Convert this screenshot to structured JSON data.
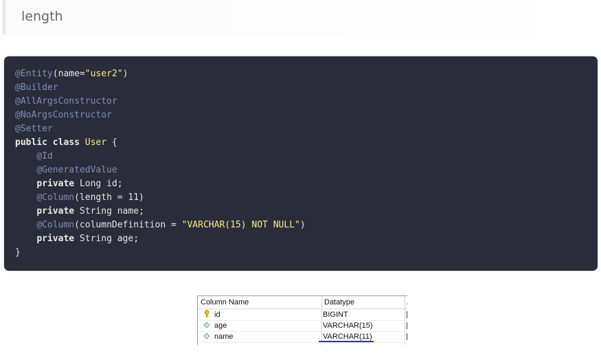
{
  "heading": {
    "text": "length"
  },
  "code_lines": [
    [
      {
        "t": "@Entity",
        "c": "ann"
      },
      {
        "t": "(name="
      },
      {
        "t": "\"user2\"",
        "c": "str"
      },
      {
        "t": ")"
      }
    ],
    [
      {
        "t": "@Builder",
        "c": "ann"
      }
    ],
    [
      {
        "t": "@AllArgsConstructor",
        "c": "ann"
      }
    ],
    [
      {
        "t": "@NoArgsConstructor",
        "c": "ann"
      }
    ],
    [
      {
        "t": "@Setter",
        "c": "ann"
      }
    ],
    [
      {
        "t": "public",
        "c": "kw"
      },
      {
        "t": " "
      },
      {
        "t": "class",
        "c": "kw"
      },
      {
        "t": " "
      },
      {
        "t": "User",
        "c": "cls"
      },
      {
        "t": " {"
      }
    ],
    [
      {
        "t": "    "
      },
      {
        "t": "@Id",
        "c": "ann"
      }
    ],
    [
      {
        "t": "    "
      },
      {
        "t": "@GeneratedValue",
        "c": "ann"
      }
    ],
    [
      {
        "t": "    "
      },
      {
        "t": "private",
        "c": "kw"
      },
      {
        "t": " Long id;"
      }
    ],
    [
      {
        "t": "    "
      },
      {
        "t": "@Column",
        "c": "ann"
      },
      {
        "t": "(length = 11)"
      }
    ],
    [
      {
        "t": "    "
      },
      {
        "t": "private",
        "c": "kw"
      },
      {
        "t": " String name;"
      }
    ],
    [
      {
        "t": "    "
      },
      {
        "t": "@Column",
        "c": "ann"
      },
      {
        "t": "(columnDefinition = "
      },
      {
        "t": "\"VARCHAR(15) NOT NULL\"",
        "c": "str"
      },
      {
        "t": ")"
      }
    ],
    [
      {
        "t": "    "
      },
      {
        "t": "private",
        "c": "kw"
      },
      {
        "t": " String age;"
      }
    ],
    [
      {
        "t": "}"
      }
    ]
  ],
  "db_table": {
    "headers": [
      "Column Name",
      "Datatype",
      "A"
    ],
    "rows": [
      {
        "icon": "key-icon",
        "name": "id",
        "type": "BIGINT"
      },
      {
        "icon": "column-icon",
        "name": "age",
        "type": "VARCHAR(15)"
      },
      {
        "icon": "column-icon",
        "name": "name",
        "type": "VARCHAR(11)"
      }
    ]
  },
  "colors": {
    "code_bg": "#2b2c3a",
    "annotation": "#7d8fb8",
    "string": "#f7e98a",
    "underline": "#2a2ad8"
  }
}
